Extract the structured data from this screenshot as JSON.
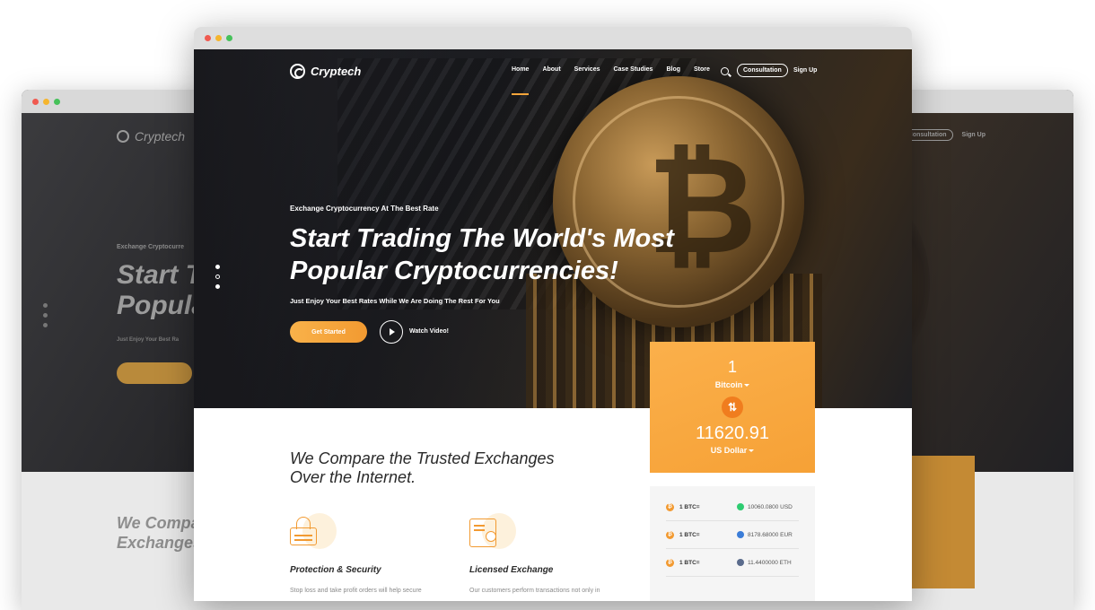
{
  "brand": "Cryptech",
  "nav": {
    "items": [
      "Home",
      "About",
      "Services",
      "Case Studies",
      "Blog",
      "Store"
    ],
    "consultation": "Consultation",
    "signup": "Sign Up"
  },
  "hero": {
    "kicker": "Exchange Cryptocurrency At The Best Rate",
    "headline": "Start Trading The World's Most Popular Cryptocurrencies!",
    "subline": "Just Enjoy Your Best Rates While We Are Doing The Rest For You",
    "cta": "Get Started",
    "watch": "Watch Video!"
  },
  "section": {
    "heading": "We Compare the Trusted Exchanges Over the Internet.",
    "features": [
      {
        "title": "Protection & Security",
        "text": "Stop loss and take profit orders will help secure"
      },
      {
        "title": "Licensed Exchange",
        "text": "Our customers perform transactions not only in"
      }
    ]
  },
  "converter": {
    "amount": "1",
    "from": "Bitcoin",
    "result": "11620.91",
    "to": "US Dollar"
  },
  "rates": [
    {
      "label": "1 BTC=",
      "value": "10060.0800 USD",
      "color": "#2ecc71"
    },
    {
      "label": "1 BTC=",
      "value": "8178.68000 EUR",
      "color": "#3b7dd8"
    },
    {
      "label": "1 BTC=",
      "value": "11.4400000 ETH",
      "color": "#5a6b8c"
    }
  ],
  "background": {
    "logo": "Cryptech",
    "kicker": "Exchange Cryptocurre",
    "headline_1": "Start T",
    "headline_2": "Popula",
    "subline": "Just Enjoy Your Best Ra",
    "cta": "Get Started",
    "section_h1": "We Compa",
    "section_h2": "Exchanges",
    "nav_consult": "Consultation",
    "nav_signup": "Sign Up"
  },
  "colors": {
    "accent": "#f6a53a",
    "accent_dark": "#f07d1e"
  }
}
